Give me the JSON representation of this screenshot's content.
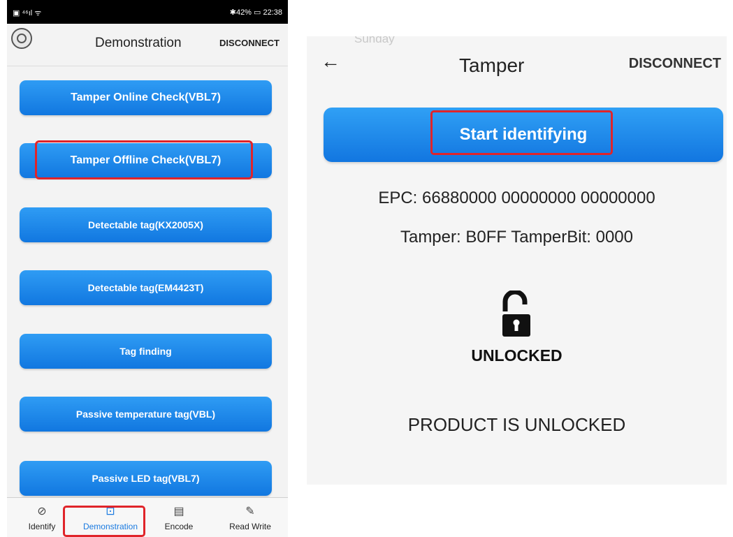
{
  "left_screen": {
    "status_bar": {
      "left": "▣ ⁴⁶ıl ᯤ",
      "right": "✱42% ▭ 22:38"
    },
    "title": "Demonstration",
    "disconnect": "DISCONNECT",
    "menu": [
      "Tamper Online Check(VBL7)",
      "Tamper Offline Check(VBL7)",
      "Detectable tag(KX2005X)",
      "Detectable tag(EM4423T)",
      "Tag finding",
      "Passive temperature tag(VBL)",
      "Passive LED tag(VBL7)"
    ],
    "bottom_nav": [
      {
        "label": "Identify",
        "icon": "tag-icon"
      },
      {
        "label": "Demonstration",
        "icon": "play-screen-icon"
      },
      {
        "label": "Encode",
        "icon": "encode-icon"
      },
      {
        "label": "Read Write",
        "icon": "edit-icon"
      }
    ],
    "highlight_color": "#e0242a",
    "accent": "#1a7ae0"
  },
  "right_screen": {
    "faded_text": "Sunday",
    "back": "←",
    "title": "Tamper",
    "disconnect": "DISCONNECT",
    "start_button": "Start identifying",
    "epc": "EPC: 66880000 00000000 00000000",
    "tamper_line": "Tamper: B0FF  TamperBit: 0000",
    "lock_state": "UNLOCKED",
    "product_status": "PRODUCT IS UNLOCKED"
  }
}
